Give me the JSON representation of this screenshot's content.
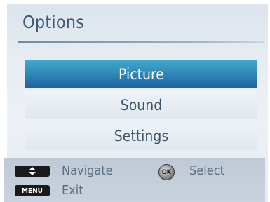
{
  "options_menu": {
    "title": "Options",
    "items": [
      {
        "label": "Picture",
        "selected": true
      },
      {
        "label": "Sound",
        "selected": false
      },
      {
        "label": "Settings",
        "selected": false
      }
    ]
  },
  "footer": {
    "navigate_icon": "up-down-arrows-icon",
    "navigate_label": "Navigate",
    "ok_key_text": "OK",
    "select_label": "Select",
    "menu_key_text": "MENU",
    "exit_label": "Exit"
  },
  "colors": {
    "selected_item": "#2f86b6",
    "title_text": "#3f5a73",
    "item_text": "#3e5469",
    "footer_bg": "#c4ced9"
  }
}
